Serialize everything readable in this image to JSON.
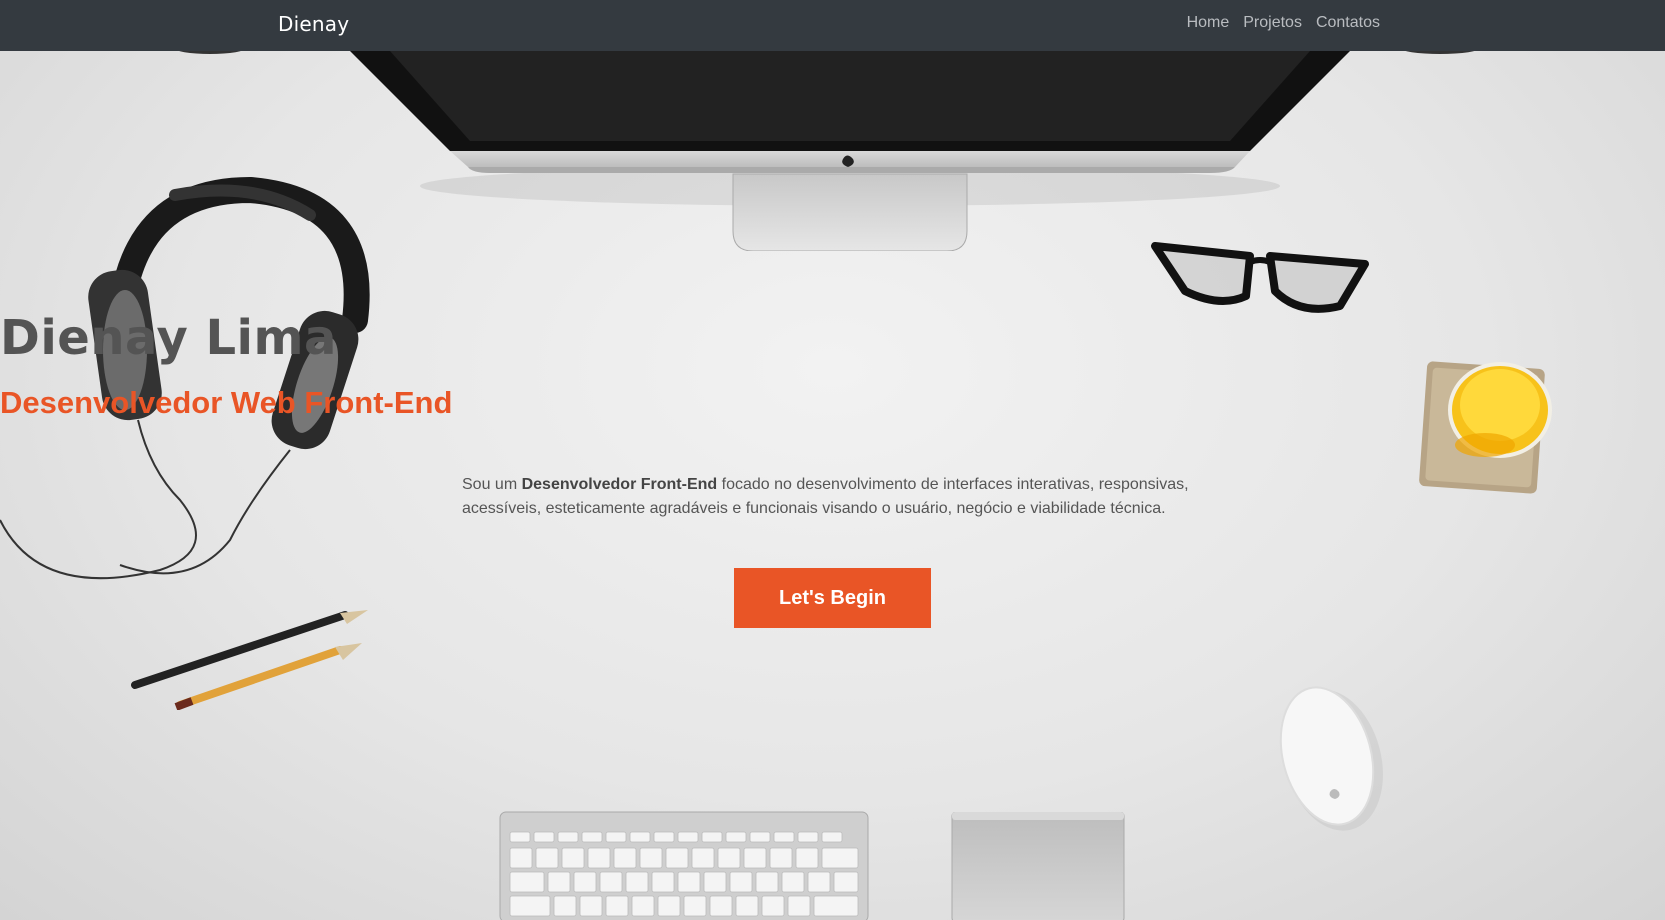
{
  "navbar": {
    "brand": "Dienay",
    "links": [
      "Home",
      "Projetos",
      "Contatos"
    ]
  },
  "hero": {
    "title": "Dienay Lima",
    "subtitle": "Desenvolvedor Web Front-End",
    "description_prefix": "Sou um ",
    "description_bold": "Desenvolvedor Front-End",
    "description_suffix": " focado no desenvolvimento de interfaces interativas, responsivas, acessíveis, esteticamente agradáveis e funcionais visando o usuário, negócio e viabilidade técnica.",
    "cta_label": "Let's Begin"
  },
  "colors": {
    "navbar_bg": "#343a40",
    "accent": "#e95526",
    "title": "#545454"
  },
  "icons": [
    "monitor-icon",
    "headphones-icon",
    "glasses-icon",
    "juice-glass-icon",
    "pencils-icon",
    "mouse-icon",
    "keyboard-icon",
    "trackpad-icon"
  ]
}
